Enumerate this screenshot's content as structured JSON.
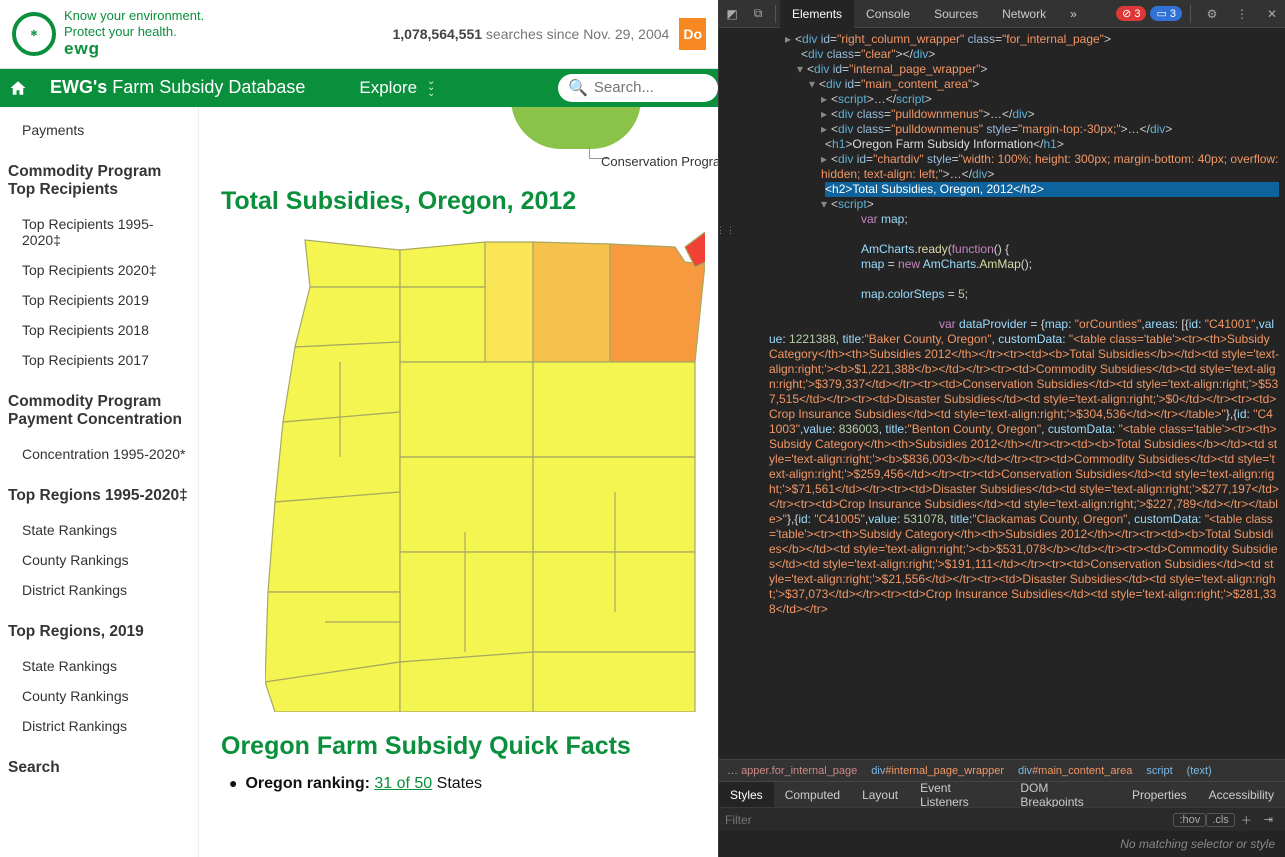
{
  "header": {
    "tagline1": "Know your environment.",
    "tagline2": "Protect your health.",
    "brand": "ewg",
    "search_count": "1,078,564,551",
    "search_since": " searches since Nov. 29, 2004",
    "donate": "Do"
  },
  "nav": {
    "brand_b": "EWG's",
    "brand_rest": " Farm Subsidy Database",
    "explore": "Explore",
    "search_ph": "Search..."
  },
  "sidebar": {
    "payments": "Payments",
    "h1": "Commodity Program Top Recipients",
    "items1": [
      "Top Recipients 1995-2020‡",
      "Top Recipients 2020‡",
      "Top Recipients 2019",
      "Top Recipients 2018",
      "Top Recipients 2017"
    ],
    "h2": "Commodity Program Payment Concentration",
    "items2": [
      "Concentration 1995-2020*"
    ],
    "h3": "Top Regions 1995-2020‡",
    "items3": [
      "State Rankings",
      "County Rankings",
      "District Rankings"
    ],
    "h4": "Top Regions, 2019",
    "items4": [
      "State Rankings",
      "County Rankings",
      "District Rankings"
    ],
    "h5": "Search"
  },
  "main": {
    "pie_label": "Conservation Programs",
    "title": "Total Subsidies, Oregon, 2012",
    "qf_title": "Oregon Farm Subsidy Quick Facts",
    "bullet_pre": "Oregon ranking: ",
    "bullet_link": "31 of 50",
    "bullet_post": " States"
  },
  "devtools": {
    "tabs": [
      "Elements",
      "Console",
      "Sources",
      "Network"
    ],
    "err": "3",
    "msg": "3",
    "styles_tabs": [
      "Styles",
      "Computed",
      "Layout",
      "Event Listeners",
      "DOM Breakpoints",
      "Properties",
      "Accessibility"
    ],
    "filter_ph": "Filter",
    "hov": ":hov",
    "cls": ".cls",
    "no_match": "No matching selector or style"
  },
  "chart_data": [
    {
      "type": "pie",
      "title": "Oregon Farm Subsidy Information",
      "note": "only bottom fragment of pie visible; one visible slice labeled",
      "series": [
        {
          "name": "Conservation Programs",
          "values": [
            null
          ]
        }
      ]
    },
    {
      "type": "heatmap",
      "title": "Total Subsidies, Oregon, 2012",
      "geo": "Oregon counties choropleth",
      "colorSteps": 5,
      "series": [
        {
          "name": "Baker County, Oregon",
          "id": "C41001",
          "value": 1221388,
          "breakdown": {
            "Total Subsidies": "$1,221,388",
            "Commodity Subsidies": "$379,337",
            "Conservation Subsidies": "$537,515",
            "Disaster Subsidies": "$0",
            "Crop Insurance Subsidies": "$304,536"
          }
        },
        {
          "name": "Benton County, Oregon",
          "id": "C41003",
          "value": 836003,
          "breakdown": {
            "Total Subsidies": "$836,003",
            "Commodity Subsidies": "$259,456",
            "Conservation Subsidies": "$71,561",
            "Disaster Subsidies": "$277,197",
            "Crop Insurance Subsidies": "$227,789"
          }
        },
        {
          "name": "Clackamas County, Oregon",
          "id": "C41005",
          "value": 531078,
          "breakdown": {
            "Total Subsidies": "$531,078",
            "Commodity Subsidies": "$191,111",
            "Conservation Subsidies": "$21,556",
            "Disaster Subsidies": "$37,073",
            "Crop Insurance Subsidies": "$281,338"
          }
        }
      ]
    }
  ]
}
